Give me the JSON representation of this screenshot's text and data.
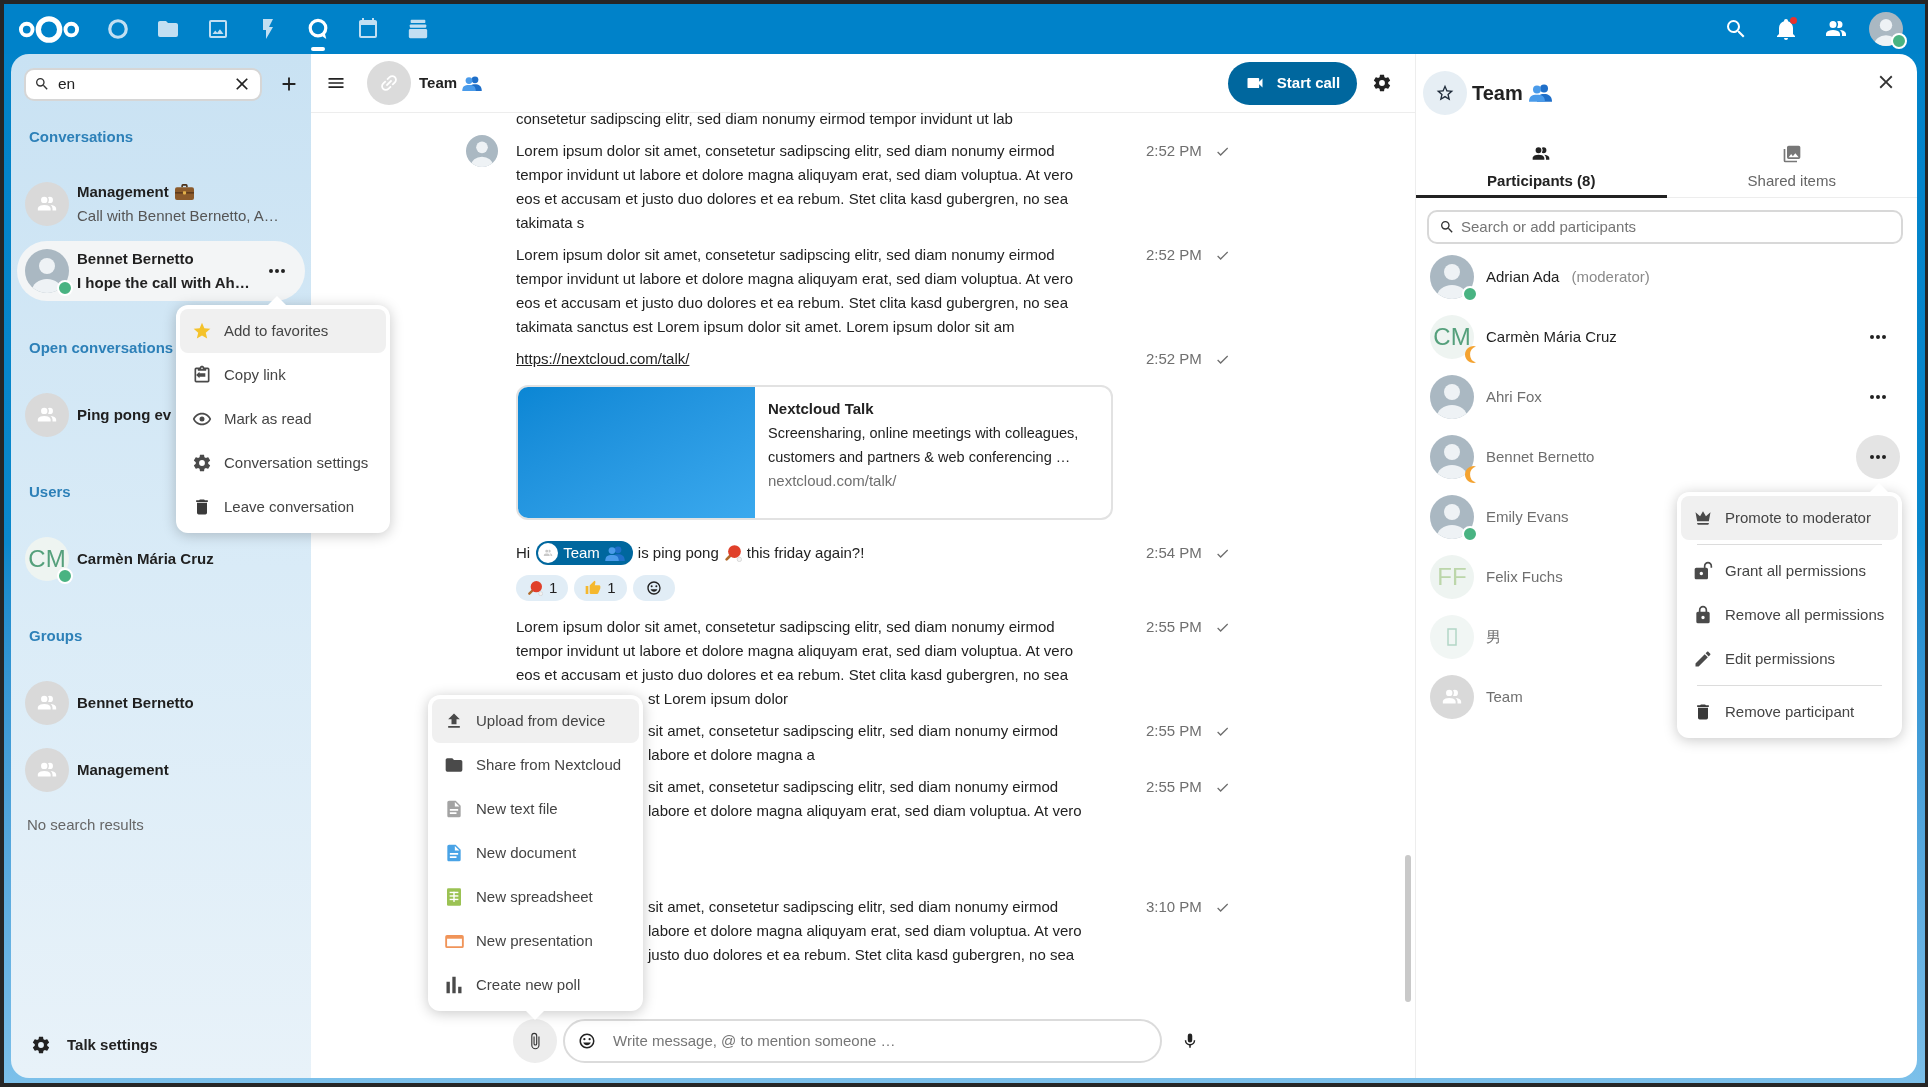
{
  "top_bar": {
    "apps": [
      {
        "kind": "dashboard",
        "selected": false
      },
      {
        "kind": "files",
        "selected": false
      },
      {
        "kind": "photos",
        "selected": false
      },
      {
        "kind": "activity",
        "selected": false
      },
      {
        "kind": "talk",
        "selected": true
      },
      {
        "kind": "calendar",
        "selected": false
      },
      {
        "kind": "deck",
        "selected": false
      }
    ],
    "actions": [
      {
        "kind": "search"
      },
      {
        "kind": "notifications",
        "unread": true
      },
      {
        "kind": "contacts"
      }
    ],
    "user": {
      "online": true
    }
  },
  "sidebar": {
    "search": {
      "value": "en"
    },
    "sections": [
      {
        "title": "Conversations",
        "items": [
          {
            "avatar": {
              "kind": "group",
              "online": false,
              "away": false
            },
            "title": "Management",
            "emoji": {
              "kind": "briefcase"
            },
            "subtitle": "Call with Bennet Bernetto, A…",
            "unread": false,
            "selected": false,
            "menu_button": false
          },
          {
            "avatar": {
              "kind": "photo",
              "online": true,
              "away": false
            },
            "title": "Bennet Bernetto",
            "subtitle": "I hope the call with Ah…",
            "unread": true,
            "selected": true,
            "menu_button": true
          }
        ]
      },
      {
        "title": "Open conversations",
        "items": [
          {
            "avatar": {
              "kind": "group",
              "online": false,
              "away": false
            },
            "title": "Ping pong ev",
            "selected": false,
            "menu_button": false
          }
        ]
      },
      {
        "title": "Users",
        "items": [
          {
            "avatar": {
              "kind": "initials",
              "initials": "CM",
              "color": "#55a07c",
              "online": true,
              "away": false
            },
            "title": "Carmèn Mária Cruz",
            "selected": false,
            "menu_button": false
          }
        ]
      },
      {
        "title": "Groups",
        "items": [
          {
            "avatar": {
              "kind": "group",
              "online": false,
              "away": false
            },
            "title": "Bennet Bernetto",
            "selected": false,
            "menu_button": false
          },
          {
            "avatar": {
              "kind": "group",
              "online": false,
              "away": false
            },
            "title": "Management",
            "selected": false,
            "menu_button": false
          }
        ]
      }
    ],
    "empty_note": "No search results",
    "settings_label": "Talk settings"
  },
  "conversation_menu": {
    "items": [
      {
        "kind": "favorite",
        "label": "Add to favorites",
        "selected": true
      },
      {
        "kind": "copy_link",
        "label": "Copy link",
        "selected": false
      },
      {
        "kind": "mark_read",
        "label": "Mark as read",
        "selected": false
      },
      {
        "kind": "settings",
        "label": "Conversation settings",
        "selected": false
      },
      {
        "kind": "leave",
        "label": "Leave conversation",
        "selected": false
      }
    ]
  },
  "chat": {
    "header": {
      "title": "Team",
      "emoji": {
        "kind": "people"
      },
      "call_button": "Start call"
    },
    "messages": [
      {
        "kind": "text",
        "avatar": false,
        "new_group": false,
        "lines": [
          "consetetur sadipscing elitr, sed diam nonumy eirmod tempor invidunt ut lab"
        ]
      },
      {
        "kind": "text",
        "avatar": true,
        "new_group": false,
        "lines": [
          "Lorem ipsum dolor sit amet, consetetur sadipscing elitr, sed diam nonumy eirmod",
          "tempor invidunt ut labore et dolore magna aliquyam erat, sed diam voluptua. At vero",
          "eos et accusam et justo duo dolores et ea rebum. Stet clita kasd gubergren, no sea",
          "takimata s"
        ],
        "time": "2:52 PM",
        "sent": true
      },
      {
        "kind": "text",
        "avatar": false,
        "new_group": false,
        "lines": [
          "Lorem ipsum dolor sit amet, consetetur sadipscing elitr, sed diam nonumy eirmod",
          "tempor invidunt ut labore et dolore magna aliquyam erat, sed diam voluptua. At vero",
          "eos et accusam et justo duo dolores et ea rebum. Stet clita kasd gubergren, no sea",
          "takimata sanctus est Lorem ipsum dolor sit amet. Lorem ipsum dolor sit am"
        ],
        "time": "2:52 PM",
        "sent": true
      },
      {
        "kind": "link",
        "avatar": false,
        "new_group": false,
        "url": "https://nextcloud.com/talk/",
        "preview": {
          "title": "Nextcloud Talk",
          "description_lines": [
            "Screensharing, online meetings with colleagues,",
            "customers and partners & web conferencing …"
          ],
          "site": "nextcloud.com/talk/"
        },
        "time": "2:52 PM",
        "sent": true
      },
      {
        "kind": "rich",
        "avatar": false,
        "new_group": false,
        "parts": [
          {
            "kind": "text",
            "text": "Hi"
          },
          {
            "kind": "mention",
            "text": "Team",
            "emoji": {
              "kind": "people"
            }
          },
          {
            "kind": "text",
            "text": "is ping pong"
          },
          {
            "kind": "emoji",
            "emoji": {
              "kind": "ping_pong"
            }
          },
          {
            "kind": "text",
            "text": "this friday again?!"
          }
        ],
        "reactions": [
          {
            "emoji": {
              "kind": "ping_pong"
            },
            "count": "1"
          },
          {
            "emoji": {
              "kind": "thumbs_up"
            },
            "count": "1"
          }
        ],
        "time": "2:54 PM",
        "sent": true
      },
      {
        "kind": "text",
        "avatar": false,
        "new_group": false,
        "lines": [
          "Lorem ipsum dolor sit amet, consetetur sadipscing elitr, sed diam nonumy eirmod",
          "tempor invidunt ut labore et dolore magna aliquyam erat, sed diam voluptua. At vero",
          "eos et accusam et justo duo dolores et ea rebum. Stet clita kasd gubergren, no sea"
        ],
        "covered_lines": [
          "st Lorem ipsum dolor"
        ],
        "time": "2:55 PM",
        "sent": true
      },
      {
        "kind": "text",
        "avatar": false,
        "new_group": false,
        "covered_lines": [
          "sit amet, consetetur sadipscing elitr, sed diam nonumy eirmod",
          "labore et dolore magna a"
        ],
        "time": "2:55 PM",
        "sent": true
      },
      {
        "kind": "text",
        "avatar": false,
        "new_group": false,
        "covered_lines": [
          "sit amet, consetetur sadipscing elitr, sed diam nonumy eirmod",
          "labore et dolore magna aliquyam erat, sed diam voluptua. At vero"
        ],
        "time": "2:55 PM",
        "sent": true
      },
      {
        "kind": "text",
        "avatar": false,
        "new_group": true,
        "covered_lines": [
          "sit amet, consetetur sadipscing elitr, sed diam nonumy eirmod",
          "labore et dolore magna aliquyam erat, sed diam voluptua. At vero",
          "justo duo dolores et ea rebum. Stet clita kasd gubergren, no sea"
        ],
        "time": "3:10 PM",
        "sent": true
      }
    ],
    "composer": {
      "placeholder": "Write message, @ to mention someone …"
    }
  },
  "attach_menu": {
    "items": [
      {
        "kind": "upload",
        "label": "Upload from device",
        "selected": true
      },
      {
        "kind": "share",
        "label": "Share from Nextcloud",
        "selected": false
      },
      {
        "kind": "text_file",
        "label": "New text file",
        "selected": false
      },
      {
        "kind": "document",
        "label": "New document",
        "selected": false
      },
      {
        "kind": "spreadsheet",
        "label": "New spreadsheet",
        "selected": false
      },
      {
        "kind": "presentation",
        "label": "New presentation",
        "selected": false
      },
      {
        "kind": "poll",
        "label": "Create new poll",
        "selected": false
      }
    ]
  },
  "details": {
    "title": "Team",
    "emoji": {
      "kind": "people"
    },
    "favorite": false,
    "tabs": [
      {
        "kind": "participants",
        "label": "Participants (8)",
        "selected": true
      },
      {
        "kind": "shared",
        "label": "Shared items",
        "selected": false
      }
    ],
    "search": {
      "placeholder": "Search or add participants"
    },
    "participants": [
      {
        "avatar": {
          "kind": "photo",
          "online": true,
          "away": false
        },
        "name": "Adrian Ada",
        "role": "(moderator)",
        "dimmed": false,
        "menu_button": false,
        "menu_open": false
      },
      {
        "avatar": {
          "kind": "initials",
          "initials": "CM",
          "color": "#55a07c",
          "online": false,
          "away": true
        },
        "name": "Carmèn Mária Cruz",
        "dimmed": false,
        "menu_button": true,
        "menu_open": false
      },
      {
        "avatar": {
          "kind": "photo",
          "online": false,
          "away": false
        },
        "name": "Ahri Fox",
        "dimmed": true,
        "menu_button": true,
        "menu_open": false
      },
      {
        "avatar": {
          "kind": "photo",
          "online": false,
          "away": true
        },
        "name": "Bennet Bernetto",
        "dimmed": true,
        "menu_button": true,
        "menu_open": true
      },
      {
        "avatar": {
          "kind": "photo",
          "online": true,
          "away": false
        },
        "name": "Emily Evans",
        "dimmed": true,
        "menu_button": false,
        "menu_open": false
      },
      {
        "avatar": {
          "kind": "initials",
          "initials": "FF",
          "color": "#bcd6aa",
          "online": false,
          "away": false
        },
        "name": "Felix Fuchs",
        "dimmed": true,
        "menu_button": false,
        "menu_open": false
      },
      {
        "avatar": {
          "kind": "glyph",
          "online": false,
          "away": false
        },
        "name": "男",
        "dimmed": true,
        "menu_button": false,
        "menu_open": false
      },
      {
        "avatar": {
          "kind": "group",
          "online": false,
          "away": false
        },
        "name": "Team",
        "dimmed": true,
        "menu_button": false,
        "menu_open": false
      }
    ],
    "participant_menu": {
      "items": [
        {
          "kind": "promote",
          "label": "Promote to moderator",
          "selected": true,
          "divider_after": true
        },
        {
          "kind": "grant",
          "label": "Grant all permissions",
          "selected": false,
          "divider_after": false
        },
        {
          "kind": "revoke",
          "label": "Remove all permissions",
          "selected": false,
          "divider_after": false
        },
        {
          "kind": "edit",
          "label": "Edit permissions",
          "selected": false,
          "divider_after": true
        },
        {
          "kind": "remove",
          "label": "Remove participant",
          "selected": false,
          "divider_after": false
        }
      ]
    }
  }
}
